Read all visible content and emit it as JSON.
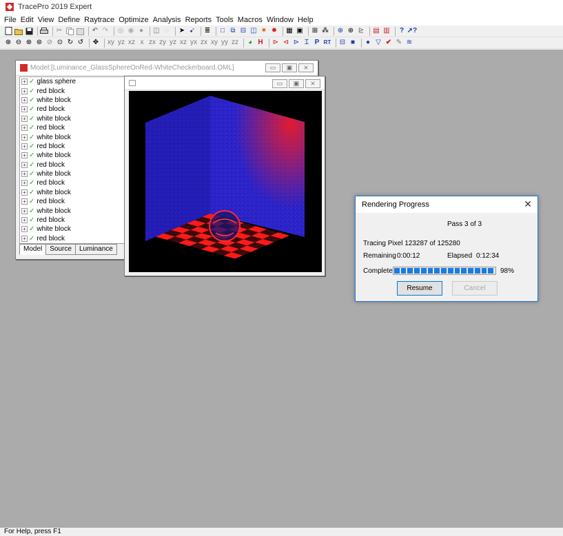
{
  "app": {
    "title": "TracePro 2019 Expert",
    "status": "For Help, press F1"
  },
  "menu": [
    "File",
    "Edit",
    "View",
    "Define",
    "Raytrace",
    "Optimize",
    "Analysis",
    "Reports",
    "Tools",
    "Macros",
    "Window",
    "Help"
  ],
  "model_window": {
    "title": "Model:[Luminance_GlassSphereOnRed-WhiteCheckerboard.OML]",
    "items": [
      "glass sphere",
      "red block",
      "white block",
      "red block",
      "white block",
      "red block",
      "white block",
      "red block",
      "white block",
      "red block",
      "white block",
      "red block",
      "white block",
      "red block",
      "white block",
      "red block",
      "white block",
      "red block"
    ],
    "tabs": [
      "Model",
      "Source",
      "Luminance"
    ]
  },
  "dialog": {
    "title": "Rendering Progress",
    "pass": "Pass 3 of 3",
    "tracing": "Tracing Pixel 123287 of 125280",
    "remaining_label": "Remaining",
    "remaining_value": "0:00:12",
    "elapsed_label": "Elapsed",
    "elapsed_value": "0:12:34",
    "complete_label": "Complete",
    "progress_percent": 98,
    "percent_text": "98%",
    "resume_label": "Resume",
    "cancel_label": "Cancel"
  },
  "colors": {
    "accent": "#1a7be0",
    "render_red": "#ff1a1a",
    "render_blue": "#2b23c8",
    "workspace": "#ababab"
  }
}
